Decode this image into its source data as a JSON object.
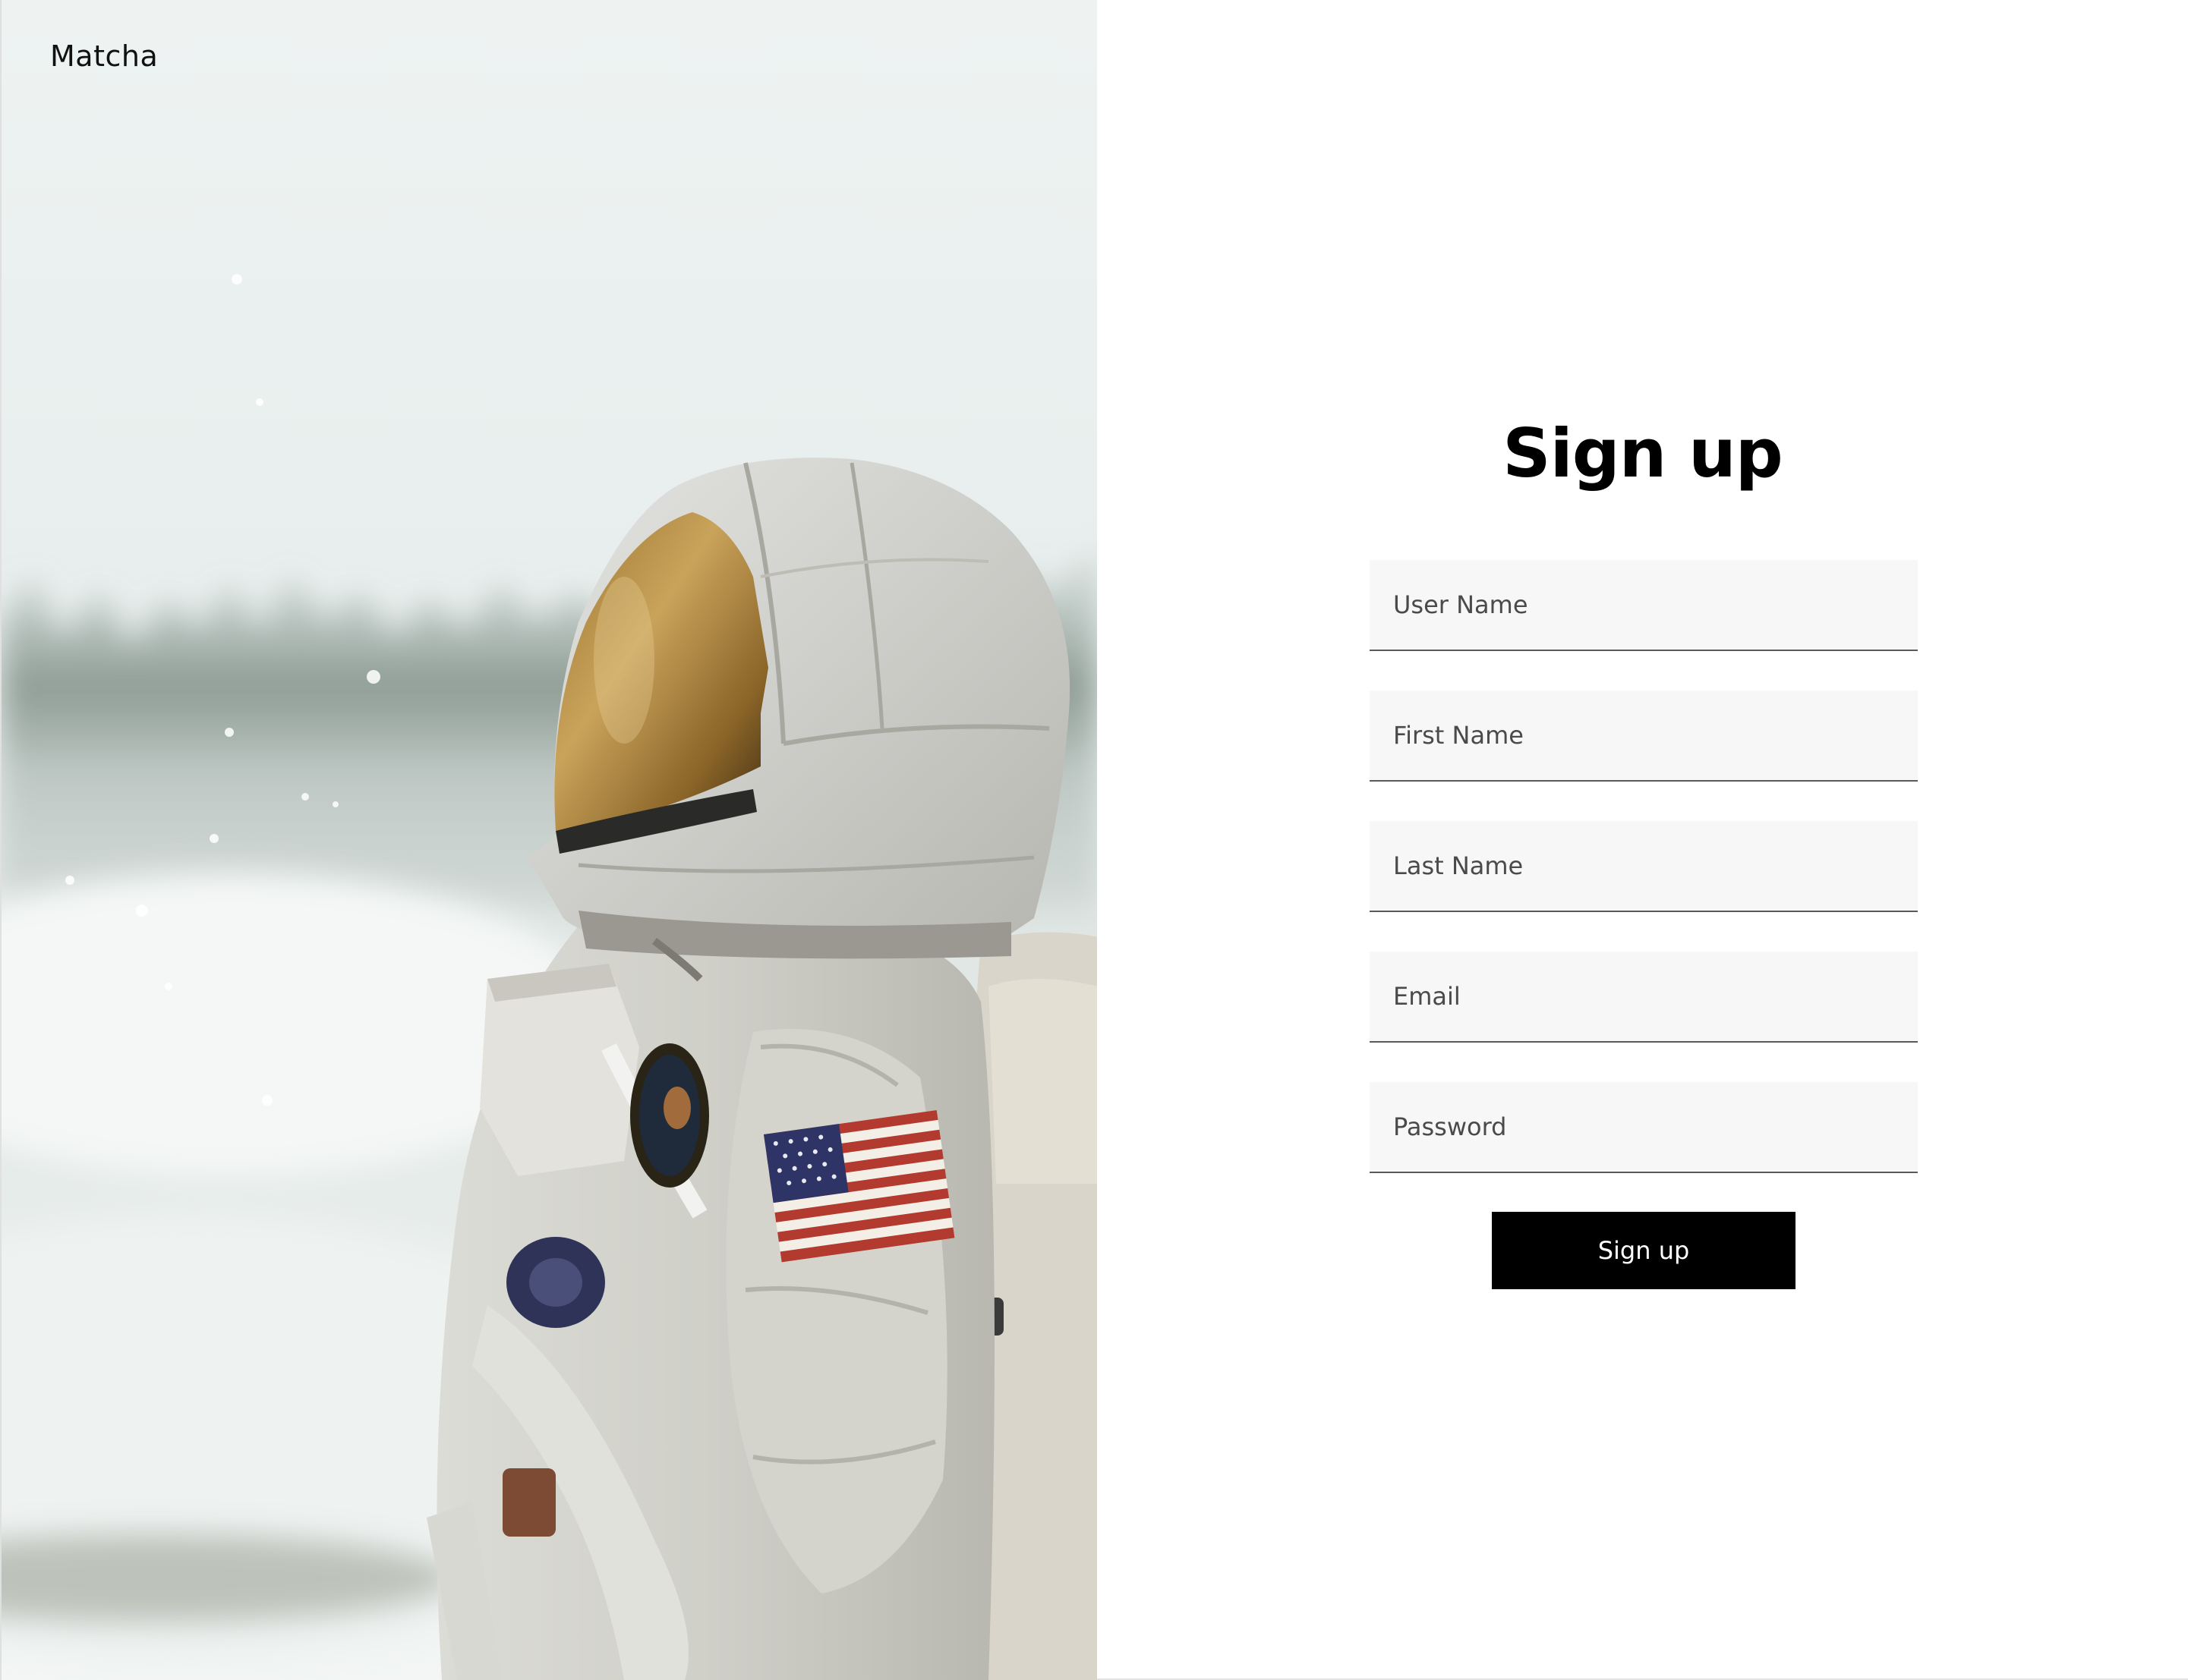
{
  "brand": {
    "name": "Matcha"
  },
  "signup": {
    "title": "Sign up",
    "fields": [
      {
        "placeholder": "User Name",
        "value": ""
      },
      {
        "placeholder": "First Name",
        "value": ""
      },
      {
        "placeholder": "Last Name",
        "value": ""
      },
      {
        "placeholder": "Email",
        "value": ""
      },
      {
        "placeholder": "Password",
        "value": ""
      }
    ],
    "submit_label": "Sign up"
  },
  "hero_image": {
    "subject": "astronaut in white spacesuit with gold visor, snowy forest background"
  },
  "colors": {
    "button_bg": "#000000",
    "button_text": "#ffffff",
    "field_bg": "#f7f7f7",
    "field_underline": "#5a5a5a"
  }
}
